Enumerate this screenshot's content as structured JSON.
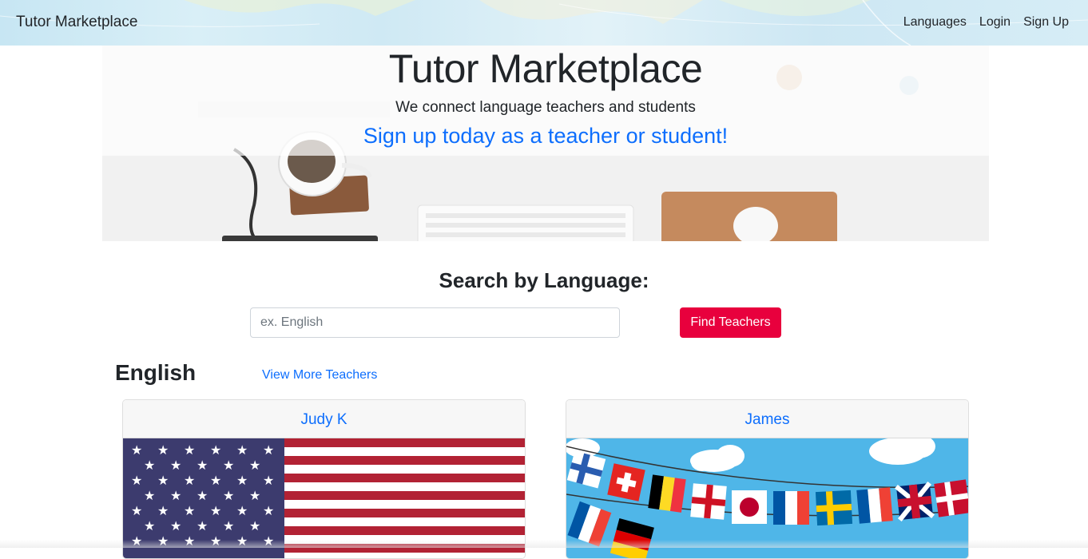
{
  "navbar": {
    "brand": "Tutor Marketplace",
    "links": [
      "Languages",
      "Login",
      "Sign Up"
    ]
  },
  "hero": {
    "title": "Tutor Marketplace",
    "subtitle": "We connect language teachers and students",
    "cta": "Sign up today as a teacher or student!"
  },
  "search": {
    "heading": "Search by Language:",
    "placeholder": "ex. English",
    "button_label": "Find Teachers"
  },
  "section": {
    "language": "English",
    "view_more": "View More Teachers"
  },
  "teachers": [
    {
      "name": "Judy K",
      "image": "us-flag-image"
    },
    {
      "name": "James",
      "image": "flag-bunting-image"
    }
  ],
  "colors": {
    "accent": "#0d6efd",
    "button": "#e8003d",
    "flag_blue": "#3c3b6e",
    "flag_red": "#b22234",
    "sky": "#4fb6e8"
  }
}
